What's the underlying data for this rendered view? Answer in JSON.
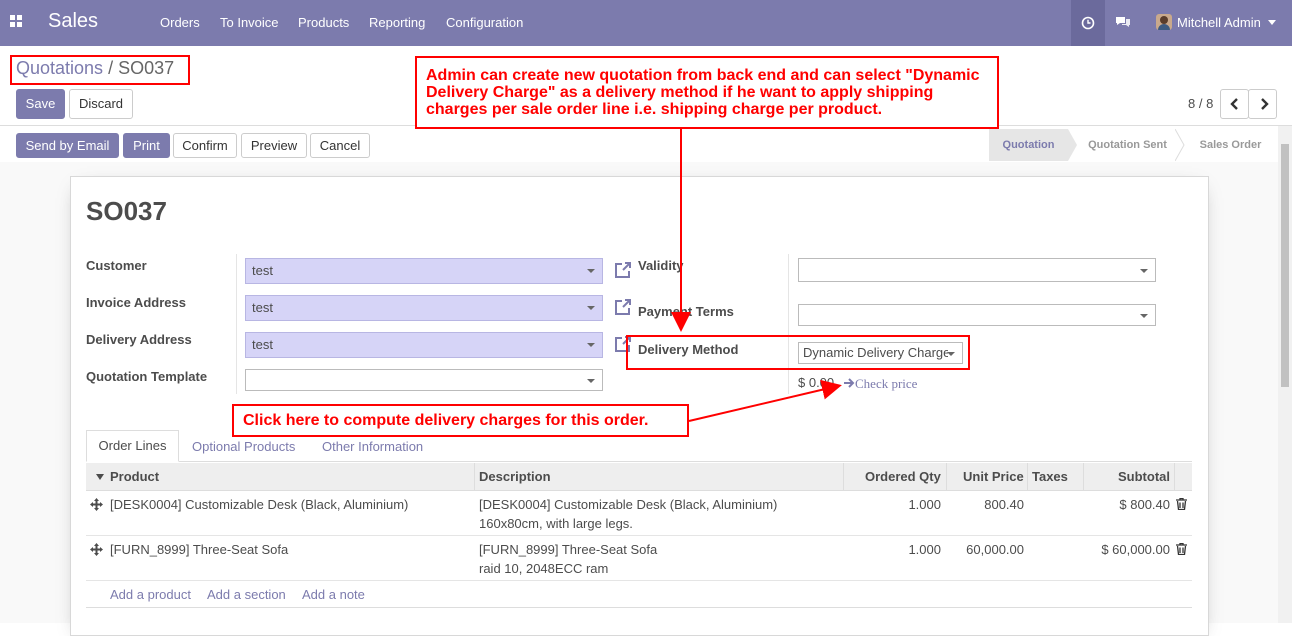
{
  "navbar": {
    "app_name": "Sales",
    "menu": [
      "Orders",
      "To Invoice",
      "Products",
      "Reporting",
      "Configuration"
    ],
    "user": "Mitchell Admin",
    "icons": [
      "apps-grid-icon",
      "activity-clock-icon",
      "chat-icon",
      "user-avatar-icon",
      "caret-down-icon"
    ]
  },
  "breadcrumb": {
    "parent": "Quotations",
    "sep": "/",
    "current": "SO037"
  },
  "controls": {
    "save": "Save",
    "discard": "Discard",
    "pager": "8 / 8"
  },
  "actions": [
    "Send by Email",
    "Print",
    "Confirm",
    "Preview",
    "Cancel"
  ],
  "stages": [
    "Quotation",
    "Quotation Sent",
    "Sales Order"
  ],
  "form": {
    "title": "SO037",
    "left": [
      {
        "label": "Customer",
        "value": "test"
      },
      {
        "label": "Invoice Address",
        "value": "test"
      },
      {
        "label": "Delivery Address",
        "value": "test"
      },
      {
        "label": "Quotation Template",
        "value": ""
      }
    ],
    "right": {
      "validity_label": "Validity",
      "validity_value": "",
      "payment_terms_label": "Payment Terms",
      "payment_terms_value": "",
      "delivery_method_label": "Delivery Method",
      "delivery_method_value": "Dynamic Delivery Charge",
      "delivery_price": "$ 0.00",
      "check_price": "Check price"
    }
  },
  "tabs": [
    "Order Lines",
    "Optional Products",
    "Other Information"
  ],
  "table": {
    "headers": [
      "Product",
      "Description",
      "Ordered Qty",
      "Unit Price",
      "Taxes",
      "Subtotal"
    ],
    "rows": [
      {
        "product": "[DESK0004] Customizable Desk (Black, Aluminium)",
        "desc1": "[DESK0004] Customizable Desk (Black, Aluminium)",
        "desc2": "160x80cm, with large legs.",
        "qty": "1.000",
        "price": "800.40",
        "taxes": "",
        "subtotal": "$ 800.40"
      },
      {
        "product": "[FURN_8999] Three-Seat Sofa",
        "desc1": "[FURN_8999] Three-Seat Sofa",
        "desc2": "raid 10, 2048ECC ram",
        "qty": "1.000",
        "price": "60,000.00",
        "taxes": "",
        "subtotal": "$ 60,000.00"
      }
    ],
    "add_links": [
      "Add a product",
      "Add a section",
      "Add a note"
    ]
  },
  "annotations": {
    "top": "Admin can create new quotation from back end and can select \"Dynamic Delivery Charge\" as a delivery method if he want to apply shipping charges per sale order line i.e. shipping charge per product.",
    "bottom": "Click here to compute delivery charges for this order."
  },
  "colors": {
    "brand": "#7c7bad",
    "annotation": "#ff0000",
    "field_filled": "#d6d4f7"
  }
}
